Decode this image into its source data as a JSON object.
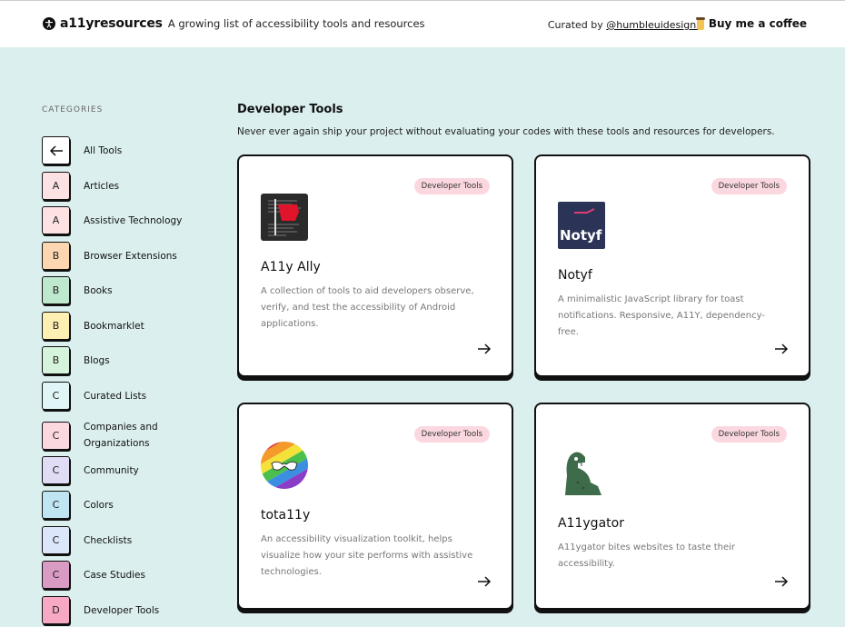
{
  "header": {
    "brand_name": "a11yresources",
    "tagline": "A growing list of accessibility tools and resources",
    "curated_prefix": "Curated by",
    "curator_handle": "@humbleuidesigns",
    "coffee_label": "Buy me a coffee"
  },
  "sidebar": {
    "heading": "CATEGORIES",
    "items": [
      {
        "badge": "",
        "label": "All Tools",
        "color": "#ffffff",
        "icon": "arrow-left-icon"
      },
      {
        "badge": "A",
        "label": "Articles",
        "color": "#fde2e4"
      },
      {
        "badge": "A",
        "label": "Assistive Technology",
        "color": "#fde2e4"
      },
      {
        "badge": "B",
        "label": "Browser Extensions",
        "color": "#fcd6b0"
      },
      {
        "badge": "B",
        "label": "Books",
        "color": "#bfe9cf"
      },
      {
        "badge": "B",
        "label": "Bookmarklet",
        "color": "#fdeeb1"
      },
      {
        "badge": "B",
        "label": "Blogs",
        "color": "#d6f4dc"
      },
      {
        "badge": "C",
        "label": "Curated Lists",
        "color": "#dff5f6"
      },
      {
        "badge": "C",
        "label": "Companies and",
        "label2": "Organizations",
        "color": "#fbd8e0"
      },
      {
        "badge": "C",
        "label": "Community",
        "color": "#e1dcf6"
      },
      {
        "badge": "C",
        "label": "Colors",
        "color": "#bfe5f2"
      },
      {
        "badge": "C",
        "label": "Checklists",
        "color": "#dbe6fb"
      },
      {
        "badge": "C",
        "label": "Case Studies",
        "color": "#d99ac4"
      },
      {
        "badge": "D",
        "label": "Developer Tools",
        "color": "#f7a8c3"
      }
    ]
  },
  "main": {
    "title": "Developer Tools",
    "description": "Never ever again ship your project without evaluating your codes with these tools and resources for developers."
  },
  "cards": [
    {
      "tag": "Developer Tools",
      "title": "A11y Ally",
      "description": "A collection of tools to aid developers observe, verify, and test the accessibility of Android applications.",
      "logo": "a11y-ally-logo"
    },
    {
      "tag": "Developer Tools",
      "title": "Notyf",
      "description": "A minimalistic JavaScript library for toast notifications. Responsive, A11Y, dependency-free.",
      "logo_text": "Notyf"
    },
    {
      "tag": "Developer Tools",
      "title": "tota11y",
      "description": "An accessibility visualization toolkit, helps visualize how your site performs with assistive technologies.",
      "logo": "tota11y-logo"
    },
    {
      "tag": "Developer Tools",
      "title": "A11ygator",
      "description": "A11ygator bites websites to taste their accessibility.",
      "logo": "alligator-logo"
    }
  ]
}
